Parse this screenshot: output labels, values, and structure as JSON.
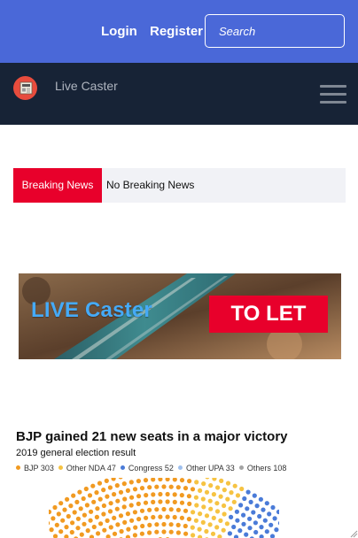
{
  "topbar": {
    "login_label": "Login",
    "register_label": "Register",
    "search_placeholder": "Search"
  },
  "navbar": {
    "logo_icon": "newspaper-icon",
    "site_name": "Live Caster",
    "menu_icon": "hamburger-menu-icon"
  },
  "ticker": {
    "label": "Breaking News",
    "text": "No Breaking News"
  },
  "banner": {
    "title": "LIVE Caster",
    "cta": "TO LET"
  },
  "article": {
    "headline": "BJP gained 21 new seats in a major victory",
    "subtitle": "2019 general election result"
  },
  "chart_data": {
    "type": "parliament",
    "title": "BJP gained 21 new seats in a major victory",
    "subtitle": "2019 general election result",
    "legend_placement": "top-left",
    "series": [
      {
        "name": "BJP",
        "value": 303,
        "label": "BJP 303",
        "color": "#f19a21"
      },
      {
        "name": "Other NDA",
        "value": 47,
        "label": "Other NDA 47",
        "color": "#f6c342"
      },
      {
        "name": "Congress",
        "value": 52,
        "label": "Congress 52",
        "color": "#4a7bd8"
      },
      {
        "name": "Other UPA",
        "value": 33,
        "label": "Other UPA 33",
        "color": "#9fc0ee"
      },
      {
        "name": "Others",
        "value": 108,
        "label": "Others 108",
        "color": "#a3a3a3"
      }
    ]
  },
  "colors": {
    "topbar": "#4a68d8",
    "navbar": "#172336",
    "breaking": "#e8002b",
    "ticker_bg": "#f1f2f6",
    "banner_title": "#45aaf7"
  }
}
